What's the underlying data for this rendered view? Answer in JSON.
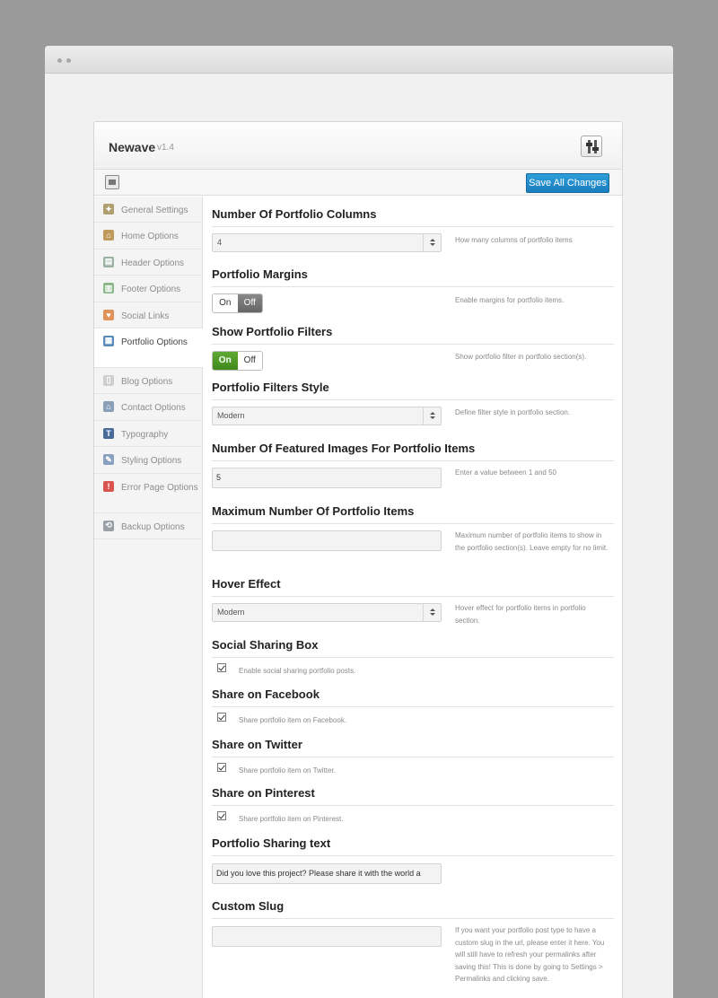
{
  "app": {
    "name": "Newave",
    "version": "v1.4"
  },
  "toolbar": {
    "save_label": "Save All Changes"
  },
  "sidebar": {
    "items": [
      {
        "label": "General Settings",
        "icon": "wand-icon",
        "color": "#b0a070"
      },
      {
        "label": "Home Options",
        "icon": "home-icon",
        "color": "#c09a5a"
      },
      {
        "label": "Header Options",
        "icon": "header-layout-icon",
        "color": "#9ab0a0"
      },
      {
        "label": "Footer Options",
        "icon": "footer-page-icon",
        "color": "#8ab88a"
      },
      {
        "label": "Social Links",
        "icon": "heart-icon",
        "color": "#e0925a"
      },
      {
        "label": "Portfolio Options",
        "icon": "portfolio-icon",
        "color": "#5a8ab8"
      },
      {
        "label": "Blog Options",
        "icon": "blog-page-icon",
        "color": "#cfcfcf"
      },
      {
        "label": "Contact Options",
        "icon": "contact-home-icon",
        "color": "#8aa0b8"
      },
      {
        "label": "Typography",
        "icon": "typography-icon",
        "color": "#4a6a9a"
      },
      {
        "label": "Styling Options",
        "icon": "brush-icon",
        "color": "#8aa0c0"
      },
      {
        "label": "Error Page Options",
        "icon": "error-icon",
        "color": "#d9534f"
      },
      {
        "label": "Backup Options",
        "icon": "backup-icon",
        "color": "#9aa0a8"
      }
    ],
    "active_index": 5
  },
  "fields": {
    "columns": {
      "title": "Number Of Portfolio Columns",
      "value": "4",
      "desc": "How many columns of portfolio items"
    },
    "margins": {
      "title": "Portfolio Margins",
      "on": "On",
      "off": "Off",
      "state": "off",
      "desc": "Enable margins for portfolio items."
    },
    "filters": {
      "title": "Show Portfolio Filters",
      "on": "On",
      "off": "Off",
      "state": "on",
      "desc": "Show portfolio filter in portfolio section(s)."
    },
    "filters_style": {
      "title": "Portfolio Filters Style",
      "value": "Modern",
      "desc": "Define filter style in portfolio section."
    },
    "featured_images": {
      "title": "Number Of Featured Images For Portfolio Items",
      "value": "5",
      "desc": "Enter a value between 1 and 50"
    },
    "max_items": {
      "title": "Maximum Number Of Portfolio Items",
      "value": "",
      "desc": "Maximum number of portfolio items to show in the portfolio section(s). Leave empty for no limit."
    },
    "hover": {
      "title": "Hover Effect",
      "value": "Modern",
      "desc": "Hover effect for portfolio items in portfolio section."
    },
    "sharing_box": {
      "title": "Social Sharing Box",
      "label": "Enable social sharing portfolio posts.",
      "checked": true
    },
    "facebook": {
      "title": "Share on Facebook",
      "label": "Share portfolio item on Facebook.",
      "checked": true
    },
    "twitter": {
      "title": "Share on Twitter",
      "label": "Share portfolio item on Twitter.",
      "checked": true
    },
    "pinterest": {
      "title": "Share on Pinterest",
      "label": "Share portfolio item on Pinterest.",
      "checked": true
    },
    "sharing_text": {
      "title": "Portfolio Sharing text",
      "value": "Did you love this project? Please share it with the world a"
    },
    "slug": {
      "title": "Custom Slug",
      "value": "",
      "desc": "If you want your portfolio post type to have a custom slug in the url, please enter it here. You will still have to refresh your permalinks after saving this! This is done by going to Settings > Permalinks and clicking save."
    }
  },
  "colors": {
    "accent": "#1f8ac9",
    "toggle_on": "#4e9a28",
    "toggle_off": "#777777"
  }
}
